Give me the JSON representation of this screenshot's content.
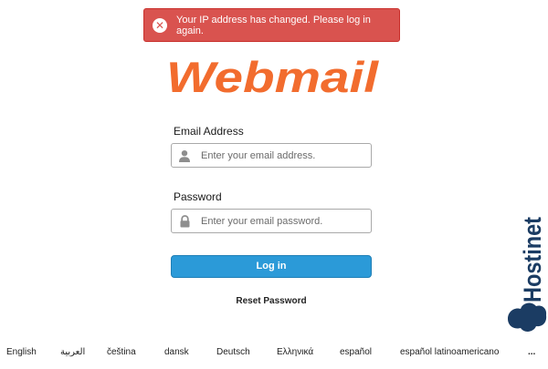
{
  "alert": {
    "message": "Your IP address has changed. Please log in again.",
    "icon": "close-circle-icon",
    "color": "#d9534f"
  },
  "logo": {
    "text": "Webmail",
    "color": "#f26c2e"
  },
  "email": {
    "label": "Email Address",
    "placeholder": "Enter your email address.",
    "value": "",
    "icon": "user-icon"
  },
  "password": {
    "label": "Password",
    "placeholder": "Enter your email password.",
    "value": "",
    "icon": "lock-icon"
  },
  "login_button": {
    "label": "Log in",
    "color": "#2b9ad8"
  },
  "reset_link": "Reset Password",
  "locales": [
    "English",
    "العربية",
    "čeština",
    "dansk",
    "Deutsch",
    "Ελληνικά",
    "español",
    "español latinoamericano",
    "..."
  ],
  "brand": {
    "text": "Hostinet",
    "color": "#1b3c63"
  }
}
